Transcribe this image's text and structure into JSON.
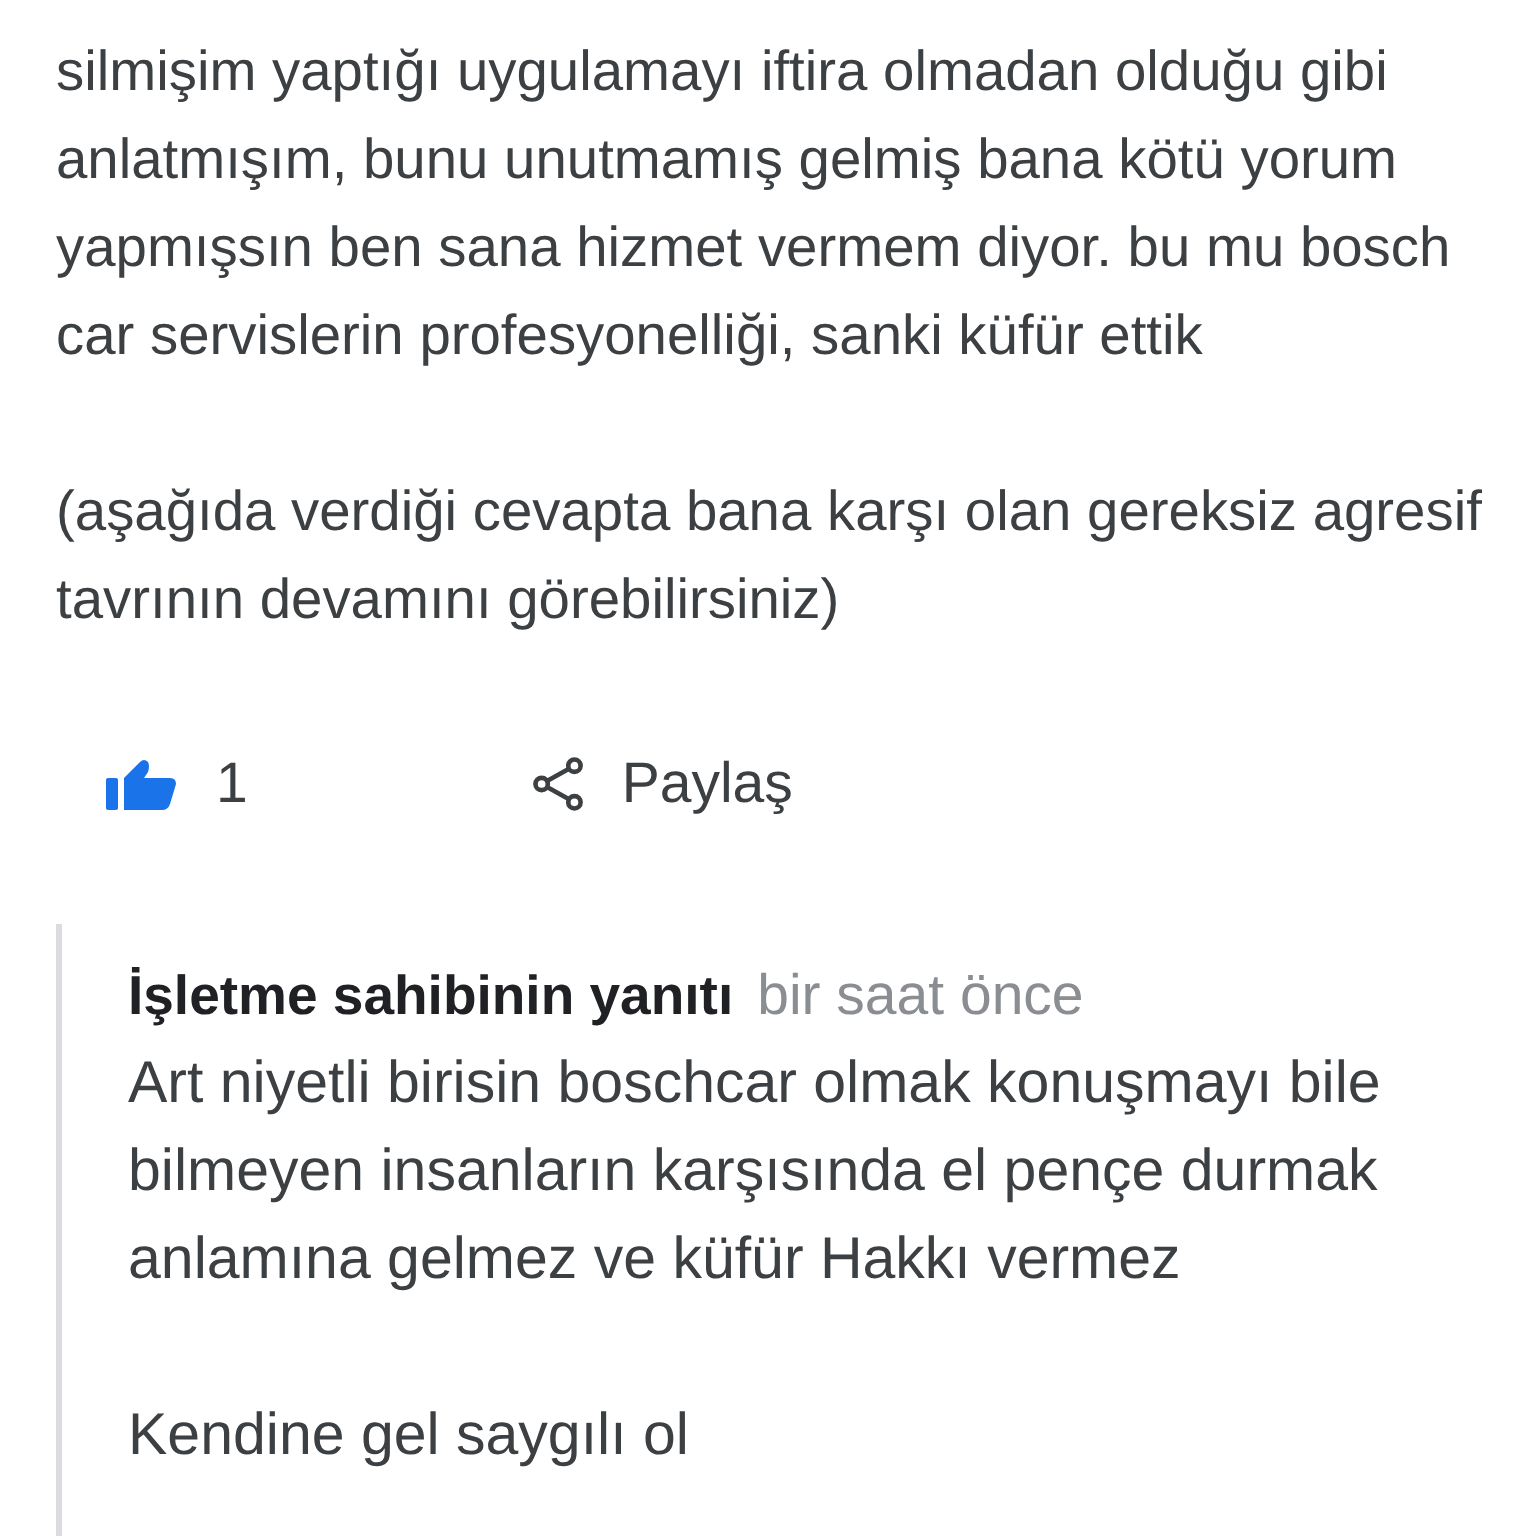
{
  "review": {
    "paragraphs": [
      "silmişim yaptığı uygulamayı iftira olmadan olduğu gibi\nanlatmışım, bunu unutmamış gelmiş bana kötü yorum\nyapmışsın ben sana hizmet vermem diyor. bu mu bosch\ncar servislerin profesyonelliği, sanki küfür ettik",
      "(aşağıda verdiği cevapta bana karşı olan gereksiz agresif\ntavrının devamını görebilirsiniz)"
    ]
  },
  "actions": {
    "like": {
      "count": "1",
      "selected": true
    },
    "share": {
      "label": "Paylaş"
    }
  },
  "owner_reply": {
    "title": "İşletme sahibinin yanıtı",
    "time": "bir saat önce",
    "paragraphs": [
      "Art niyetli birisin boschcar olmak konuşmayı bile\nbilmeyen insanların karşısında el pençe durmak\nanlamına gelmez ve küfür Hakkı vermez",
      "Kendine gel saygılı ol"
    ]
  }
}
